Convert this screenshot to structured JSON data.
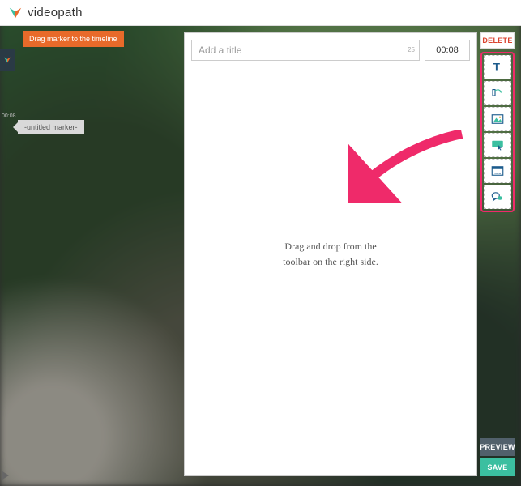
{
  "brand": {
    "name": "videopath"
  },
  "tip": {
    "text": "Drag marker to the timeline"
  },
  "timeline": {
    "time_label": "00:08",
    "marker_label": "-untitled marker-"
  },
  "editor": {
    "title_placeholder": "Add a title",
    "char_limit": "25",
    "timestamp": "00:08",
    "body_hint_line1": "Drag and drop from the",
    "body_hint_line2": "toolbar on the right side."
  },
  "rail": {
    "delete": "DELETE",
    "preview": "PREVIEW",
    "save": "SAVE",
    "tools": [
      {
        "name": "text-tool-icon"
      },
      {
        "name": "media-tool-icon"
      },
      {
        "name": "image-tool-icon"
      },
      {
        "name": "button-tool-icon"
      },
      {
        "name": "website-tool-icon"
      },
      {
        "name": "social-tool-icon"
      }
    ]
  }
}
